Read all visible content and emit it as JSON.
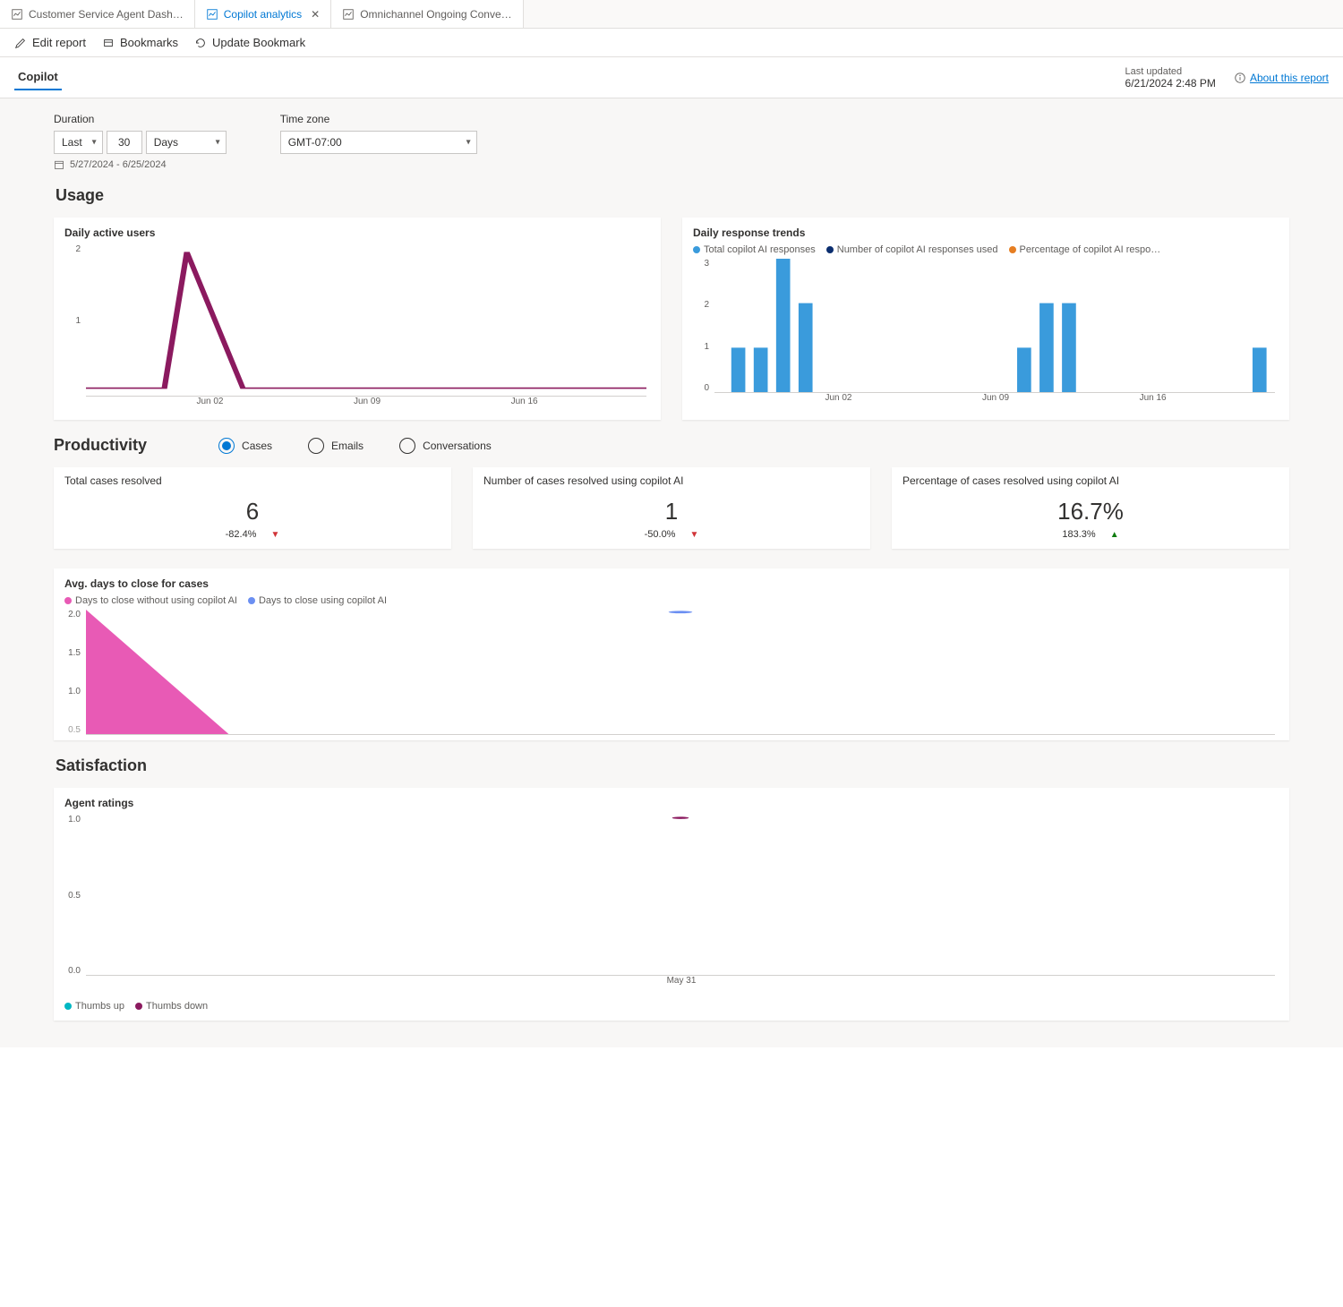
{
  "tabs": [
    {
      "label": "Customer Service Agent Dash…",
      "active": false
    },
    {
      "label": "Copilot analytics",
      "active": true
    },
    {
      "label": "Omnichannel Ongoing Conve…",
      "active": false
    }
  ],
  "toolbar": {
    "edit": "Edit report",
    "bookmarks": "Bookmarks",
    "update": "Update Bookmark"
  },
  "report_tab": "Copilot",
  "last_updated": {
    "label": "Last updated",
    "value": "6/21/2024 2:48 PM"
  },
  "about_link": "About this report",
  "filters": {
    "duration_label": "Duration",
    "duration_last": "Last",
    "duration_num": "30",
    "duration_unit": "Days",
    "date_range": "5/27/2024 - 6/25/2024",
    "tz_label": "Time zone",
    "tz_value": "GMT-07:00"
  },
  "usage": {
    "title": "Usage",
    "dau_title": "Daily active users",
    "trends_title": "Daily response trends",
    "legend": {
      "total": "Total copilot AI responses",
      "used": "Number of copilot AI responses used",
      "pct": "Percentage of copilot AI respo…"
    }
  },
  "productivity": {
    "title": "Productivity",
    "radios": {
      "cases": "Cases",
      "emails": "Emails",
      "conversations": "Conversations"
    },
    "kpi1": {
      "title": "Total cases resolved",
      "value": "6",
      "delta": "-82.4%"
    },
    "kpi2": {
      "title": "Number of cases resolved using copilot AI",
      "value": "1",
      "delta": "-50.0%"
    },
    "kpi3": {
      "title": "Percentage of cases resolved using copilot AI",
      "value": "16.7%",
      "delta": "183.3%"
    },
    "avg_title": "Avg. days to close for cases",
    "avg_legend": {
      "without": "Days to close without using copilot AI",
      "with": "Days to close using copilot AI"
    }
  },
  "satisfaction": {
    "title": "Satisfaction",
    "chart_title": "Agent ratings",
    "legend": {
      "up": "Thumbs up",
      "down": "Thumbs down"
    },
    "x_tick": "May 31"
  },
  "chart_data": [
    {
      "id": "daily_active_users",
      "type": "line",
      "title": "Daily active users",
      "x_ticks": [
        "Jun 02",
        "Jun 09",
        "Jun 16"
      ],
      "y_ticks": [
        1,
        2
      ],
      "ylim": [
        0.9,
        2.1
      ],
      "series": [
        {
          "name": "Daily active users",
          "color": "#8b1a5f",
          "points": [
            {
              "x": "May 27",
              "y": 1
            },
            {
              "x": "May 28",
              "y": 1
            },
            {
              "x": "May 29",
              "y": 1
            },
            {
              "x": "May 30",
              "y": 1
            },
            {
              "x": "May 31",
              "y": 2
            },
            {
              "x": "Jun 01",
              "y": 1.5
            },
            {
              "x": "Jun 02",
              "y": 1
            },
            {
              "x": "Jun 03",
              "y": 1
            },
            {
              "x": "Jun 04",
              "y": 1
            },
            {
              "x": "Jun 05",
              "y": 1
            },
            {
              "x": "Jun 06",
              "y": 1
            },
            {
              "x": "Jun 07",
              "y": 1
            },
            {
              "x": "Jun 08",
              "y": 1
            },
            {
              "x": "Jun 09",
              "y": 1
            },
            {
              "x": "Jun 10",
              "y": 1
            },
            {
              "x": "Jun 11",
              "y": 1
            },
            {
              "x": "Jun 12",
              "y": 1
            },
            {
              "x": "Jun 13",
              "y": 1
            },
            {
              "x": "Jun 14",
              "y": 1
            },
            {
              "x": "Jun 15",
              "y": 1
            },
            {
              "x": "Jun 16",
              "y": 1
            },
            {
              "x": "Jun 17",
              "y": 1
            },
            {
              "x": "Jun 18",
              "y": 1
            },
            {
              "x": "Jun 19",
              "y": 1
            },
            {
              "x": "Jun 20",
              "y": 1
            },
            {
              "x": "Jun 21",
              "y": 1
            }
          ]
        }
      ]
    },
    {
      "id": "daily_response_trends",
      "type": "bar",
      "title": "Daily response trends",
      "x_ticks": [
        "Jun 02",
        "Jun 09",
        "Jun 16"
      ],
      "y_ticks": [
        0,
        1,
        2,
        3
      ],
      "ylim": [
        0,
        3
      ],
      "series": [
        {
          "name": "Total copilot AI responses",
          "color": "#3a9bdc",
          "bars": [
            {
              "x": "May 28",
              "y": 1
            },
            {
              "x": "May 29",
              "y": 1
            },
            {
              "x": "May 30",
              "y": 3
            },
            {
              "x": "May 31",
              "y": 2
            },
            {
              "x": "Jun 09",
              "y": 1
            },
            {
              "x": "Jun 10",
              "y": 2
            },
            {
              "x": "Jun 11",
              "y": 2
            },
            {
              "x": "Jun 21",
              "y": 1
            }
          ]
        }
      ],
      "legend_colors": {
        "total": "#3a9bdc",
        "used": "#0b2e6f",
        "pct": "#e67e22"
      }
    },
    {
      "id": "avg_days_to_close",
      "type": "area",
      "title": "Avg. days to close for cases",
      "y_ticks": [
        0.5,
        1.0,
        1.5,
        2.0
      ],
      "ylim": [
        0.5,
        2.0
      ],
      "series": [
        {
          "name": "Days to close without using copilot AI",
          "color": "#e85ab5",
          "points": [
            {
              "x": "May 27",
              "y": 2.0
            },
            {
              "x": "May 30",
              "y": 0.5
            }
          ]
        },
        {
          "name": "Days to close using copilot AI",
          "color": "#6b8ff2",
          "points": [
            {
              "x": "Jun 09",
              "y": 2.0
            }
          ]
        }
      ]
    },
    {
      "id": "agent_ratings",
      "type": "scatter",
      "title": "Agent ratings",
      "y_ticks": [
        0.0,
        0.5,
        1.0
      ],
      "ylim": [
        0,
        1
      ],
      "x_ticks": [
        "May 31"
      ],
      "series": [
        {
          "name": "Thumbs up",
          "color": "#00b7c3",
          "points": []
        },
        {
          "name": "Thumbs down",
          "color": "#8b1a5f",
          "points": [
            {
              "x": "May 31",
              "y": 1.0
            }
          ]
        }
      ]
    }
  ]
}
